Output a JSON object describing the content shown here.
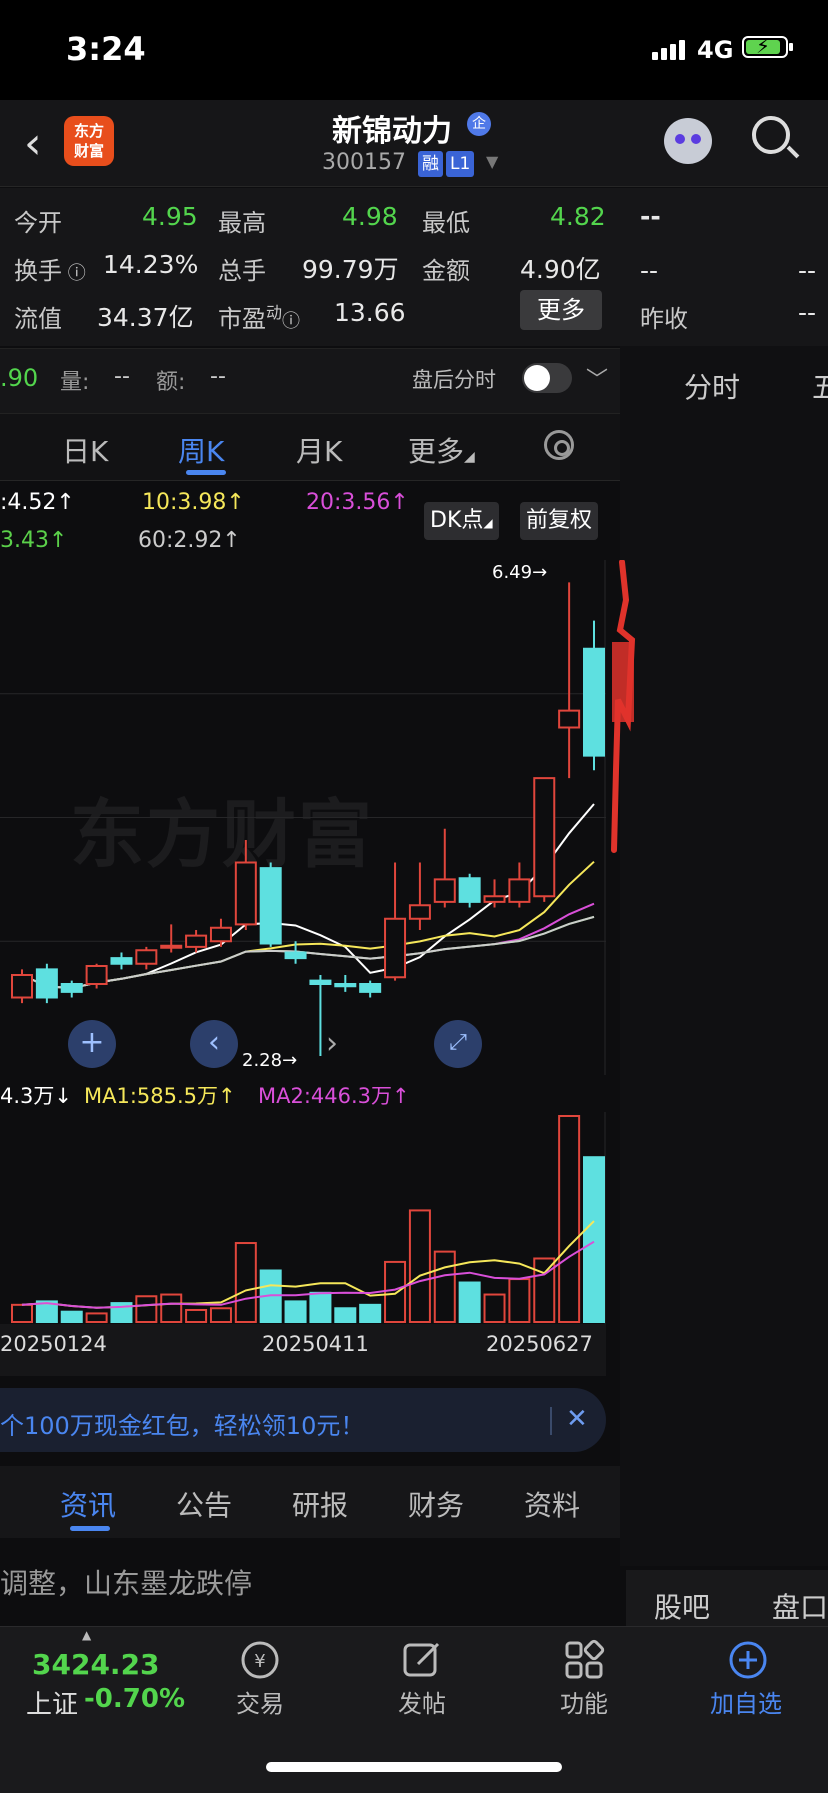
{
  "status_bar": {
    "time": "3:24",
    "network": "4G"
  },
  "header": {
    "name": "新锦动力",
    "qi_badge": "企",
    "code": "300157",
    "tags": [
      "融",
      "L1"
    ],
    "logo_text": [
      "东方",
      "财富"
    ]
  },
  "quote": {
    "rows": [
      [
        {
          "label": "今开",
          "value": "4.95"
        },
        {
          "label": "最高",
          "value": "4.98"
        },
        {
          "label": "最低",
          "value": "4.82"
        }
      ],
      [
        {
          "label": "换手",
          "value": "14.23%"
        },
        {
          "label": "总手",
          "value": "99.79万"
        },
        {
          "label": "金额",
          "value": "4.90亿"
        }
      ],
      [
        {
          "label": "流值",
          "value": "34.37亿"
        },
        {
          "label": "市盈",
          "sup": "动",
          "value": "13.66"
        }
      ]
    ],
    "more_label": "更多",
    "right_dash_top": "--",
    "right_dash_a": "--",
    "right_dash_b": "--",
    "prev_close_label": "昨收",
    "prev_close_value": "--"
  },
  "sub_bar": {
    "price_fragment": ".90",
    "volume_label": "量:",
    "volume_value": "--",
    "amount_label": "额:",
    "amount_value": "--",
    "after_hours": "盘后分时"
  },
  "right_tabs": {
    "top": "分时",
    "top2": "五",
    "bottom": "股吧",
    "bottom2": "盘口"
  },
  "kline_tabs": [
    "日K",
    "周K",
    "月K",
    "更多"
  ],
  "ma_line1": {
    "ma5": ":4.52↑",
    "ma10": "10:3.98↑",
    "ma20": "20:3.56↑"
  },
  "ma_line2": {
    "ma30": "3.43↑",
    "ma60": "60:2.92↑"
  },
  "chart_buttons": {
    "dk": "DK点",
    "adjust": "前复权"
  },
  "price_annotations": {
    "high": "6.49→",
    "low": "2.28→"
  },
  "volume_legend": {
    "vol": "4.3万↓",
    "ma1": "MA1:585.5万↑",
    "ma2": "MA2:446.3万↑"
  },
  "colors": {
    "up": "#e0463c",
    "down": "#5ee0e0",
    "ma5": "#ffffff",
    "ma10": "#f5e75a",
    "ma20": "#d94fd9",
    "ma30": "#5bd04a",
    "ma60": "#cccccc",
    "accent": "#4a86f0"
  },
  "chart_data": {
    "type": "candlestick",
    "x_labels": [
      "20250124",
      "20250411",
      "20250627"
    ],
    "candles": [
      {
        "o": 2.8,
        "c": 3.0,
        "h": 3.05,
        "l": 2.75
      },
      {
        "o": 3.05,
        "c": 2.8,
        "h": 3.1,
        "l": 2.75
      },
      {
        "o": 2.92,
        "c": 2.85,
        "h": 2.95,
        "l": 2.8
      },
      {
        "o": 2.92,
        "c": 3.08,
        "h": 3.1,
        "l": 2.88
      },
      {
        "o": 3.15,
        "c": 3.1,
        "h": 3.2,
        "l": 3.05
      },
      {
        "o": 3.1,
        "c": 3.22,
        "h": 3.25,
        "l": 3.05
      },
      {
        "o": 3.25,
        "c": 3.26,
        "h": 3.45,
        "l": 3.2
      },
      {
        "o": 3.25,
        "c": 3.35,
        "h": 3.4,
        "l": 3.2
      },
      {
        "o": 3.3,
        "c": 3.42,
        "h": 3.5,
        "l": 3.25
      },
      {
        "o": 3.45,
        "c": 4.0,
        "h": 4.2,
        "l": 3.4
      },
      {
        "o": 3.95,
        "c": 3.28,
        "h": 4.0,
        "l": 3.25
      },
      {
        "o": 3.2,
        "c": 3.15,
        "h": 3.3,
        "l": 3.1
      },
      {
        "o": 2.95,
        "c": 2.92,
        "h": 3.0,
        "l": 2.28
      },
      {
        "o": 2.92,
        "c": 2.9,
        "h": 3.0,
        "l": 2.85
      },
      {
        "o": 2.92,
        "c": 2.85,
        "h": 2.95,
        "l": 2.8
      },
      {
        "o": 2.98,
        "c": 3.5,
        "h": 4.0,
        "l": 2.95
      },
      {
        "o": 3.5,
        "c": 3.62,
        "h": 4.0,
        "l": 3.4
      },
      {
        "o": 3.65,
        "c": 3.85,
        "h": 4.3,
        "l": 3.6
      },
      {
        "o": 3.86,
        "c": 3.65,
        "h": 3.9,
        "l": 3.6
      },
      {
        "o": 3.65,
        "c": 3.7,
        "h": 3.85,
        "l": 3.6
      },
      {
        "o": 3.65,
        "c": 3.85,
        "h": 4.0,
        "l": 3.6
      },
      {
        "o": 3.7,
        "c": 4.75,
        "h": 4.75,
        "l": 3.65
      },
      {
        "o": 5.2,
        "c": 5.35,
        "h": 6.49,
        "l": 4.75
      },
      {
        "o": 5.9,
        "c": 4.95,
        "h": 6.15,
        "l": 4.82
      }
    ],
    "volumes": [
      1.0,
      1.2,
      0.6,
      0.5,
      1.1,
      1.5,
      1.6,
      0.7,
      0.8,
      4.6,
      3.0,
      1.2,
      1.7,
      0.8,
      1.0,
      3.5,
      6.5,
      4.1,
      2.3,
      1.6,
      2.5,
      3.7,
      12.0,
      9.6
    ],
    "price_range": [
      2.2,
      6.6
    ]
  },
  "banner": {
    "text": "个100万现金红包，轻松领10元！"
  },
  "news_tabs": [
    "资讯",
    "公告",
    "研报",
    "财务",
    "资料"
  ],
  "news_headline": "调整，山东墨龙跌停",
  "bottom_nav": {
    "index_value": "3424.23",
    "index_name": "上证",
    "index_change": "-0.70%",
    "items": [
      {
        "icon": "trade-icon",
        "label": "交易"
      },
      {
        "icon": "post-icon",
        "label": "发帖"
      },
      {
        "icon": "function-icon",
        "label": "功能"
      },
      {
        "icon": "add-watchlist-icon",
        "label": "加自选"
      }
    ]
  }
}
